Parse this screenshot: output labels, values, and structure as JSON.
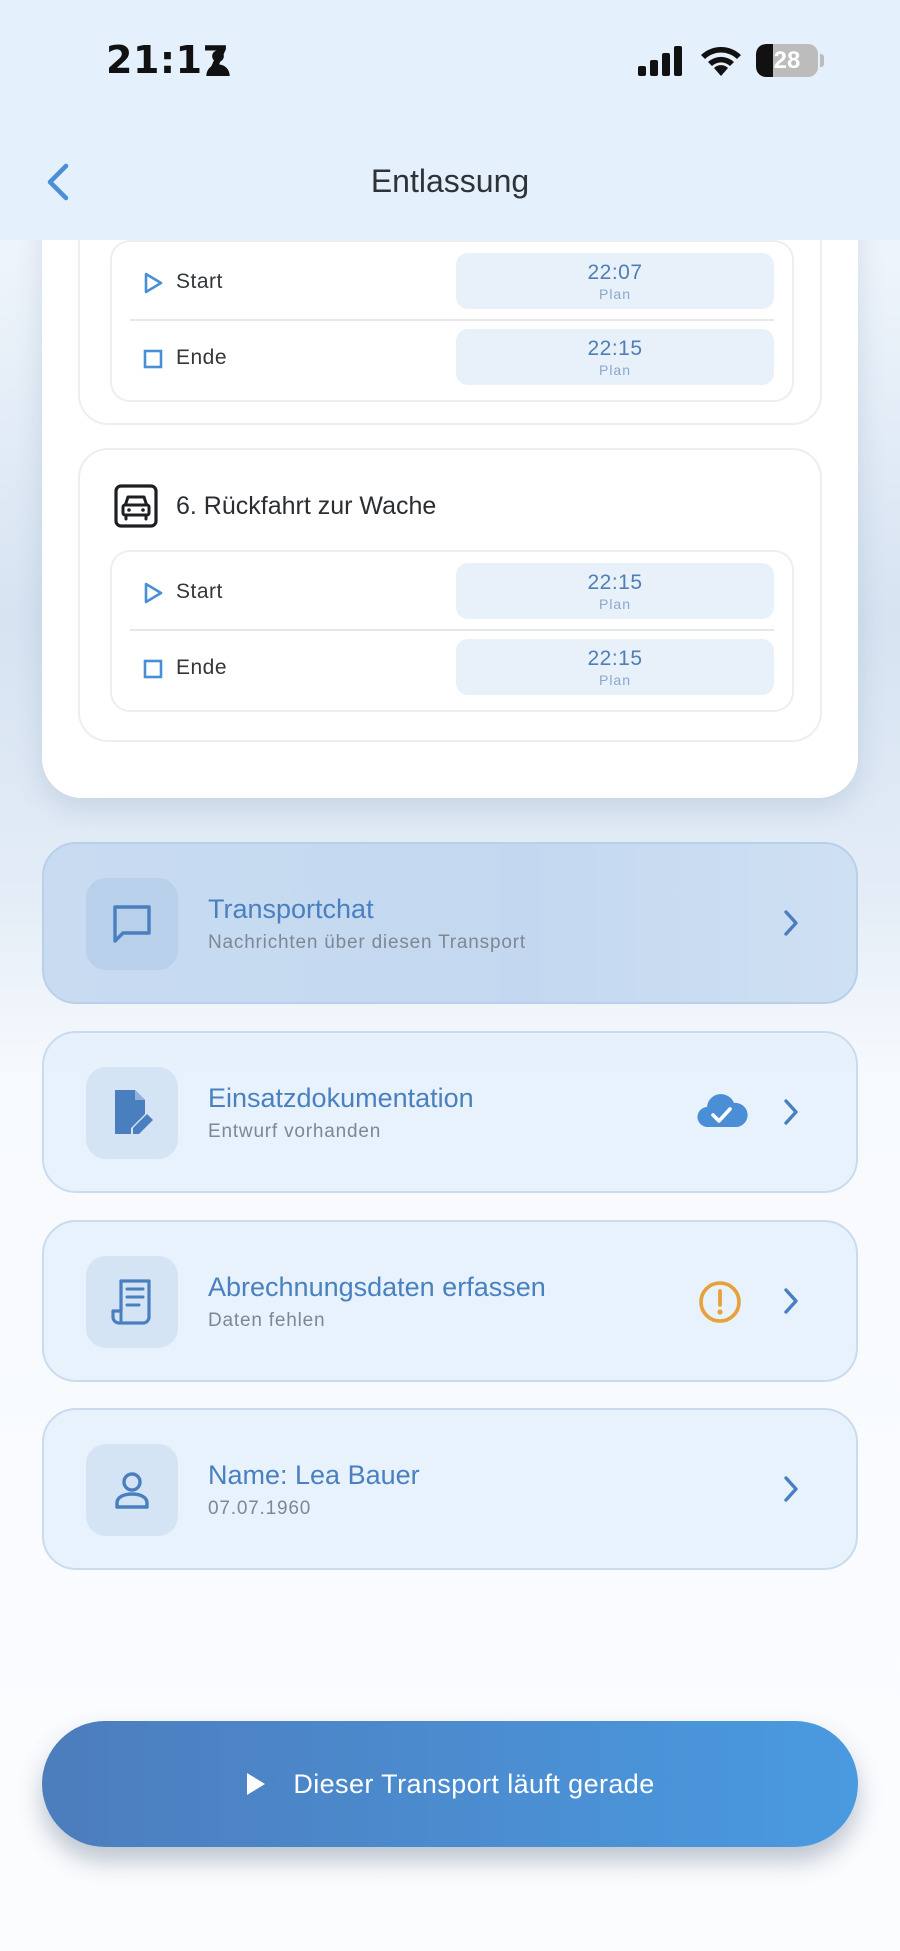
{
  "status_bar": {
    "time": "21:17",
    "battery": "28",
    "battery_level": 0.28
  },
  "nav": {
    "title": "Entlassung"
  },
  "segments": [
    {
      "title": "",
      "start_label": "Start",
      "start_time": "22:07",
      "start_tag": "Plan",
      "end_label": "Ende",
      "end_time": "22:15",
      "end_tag": "Plan"
    },
    {
      "title": "6. Rückfahrt zur Wache",
      "start_label": "Start",
      "start_time": "22:15",
      "start_tag": "Plan",
      "end_label": "Ende",
      "end_time": "22:15",
      "end_tag": "Plan"
    }
  ],
  "list": [
    {
      "title": "Transportchat",
      "subtitle": "Nachrichten über diesen Transport",
      "icon": "chat-icon"
    },
    {
      "title": "Einsatzdokumentation",
      "subtitle": "Entwurf vorhanden",
      "icon": "document-edit-icon",
      "status_icon": "cloud-check-icon"
    },
    {
      "title": "Abrechnungsdaten erfassen",
      "subtitle": "Daten fehlen",
      "icon": "receipt-icon",
      "status_icon": "warning-icon"
    },
    {
      "title": "Name: Lea Bauer",
      "subtitle": "07.07.1960",
      "icon": "person-icon"
    }
  ],
  "cta": {
    "label": "Dieser Transport läuft gerade"
  },
  "colors": {
    "accent": "#4A80C0",
    "warning": "#E8A03A",
    "chip_bg": "#E8F0FA"
  }
}
